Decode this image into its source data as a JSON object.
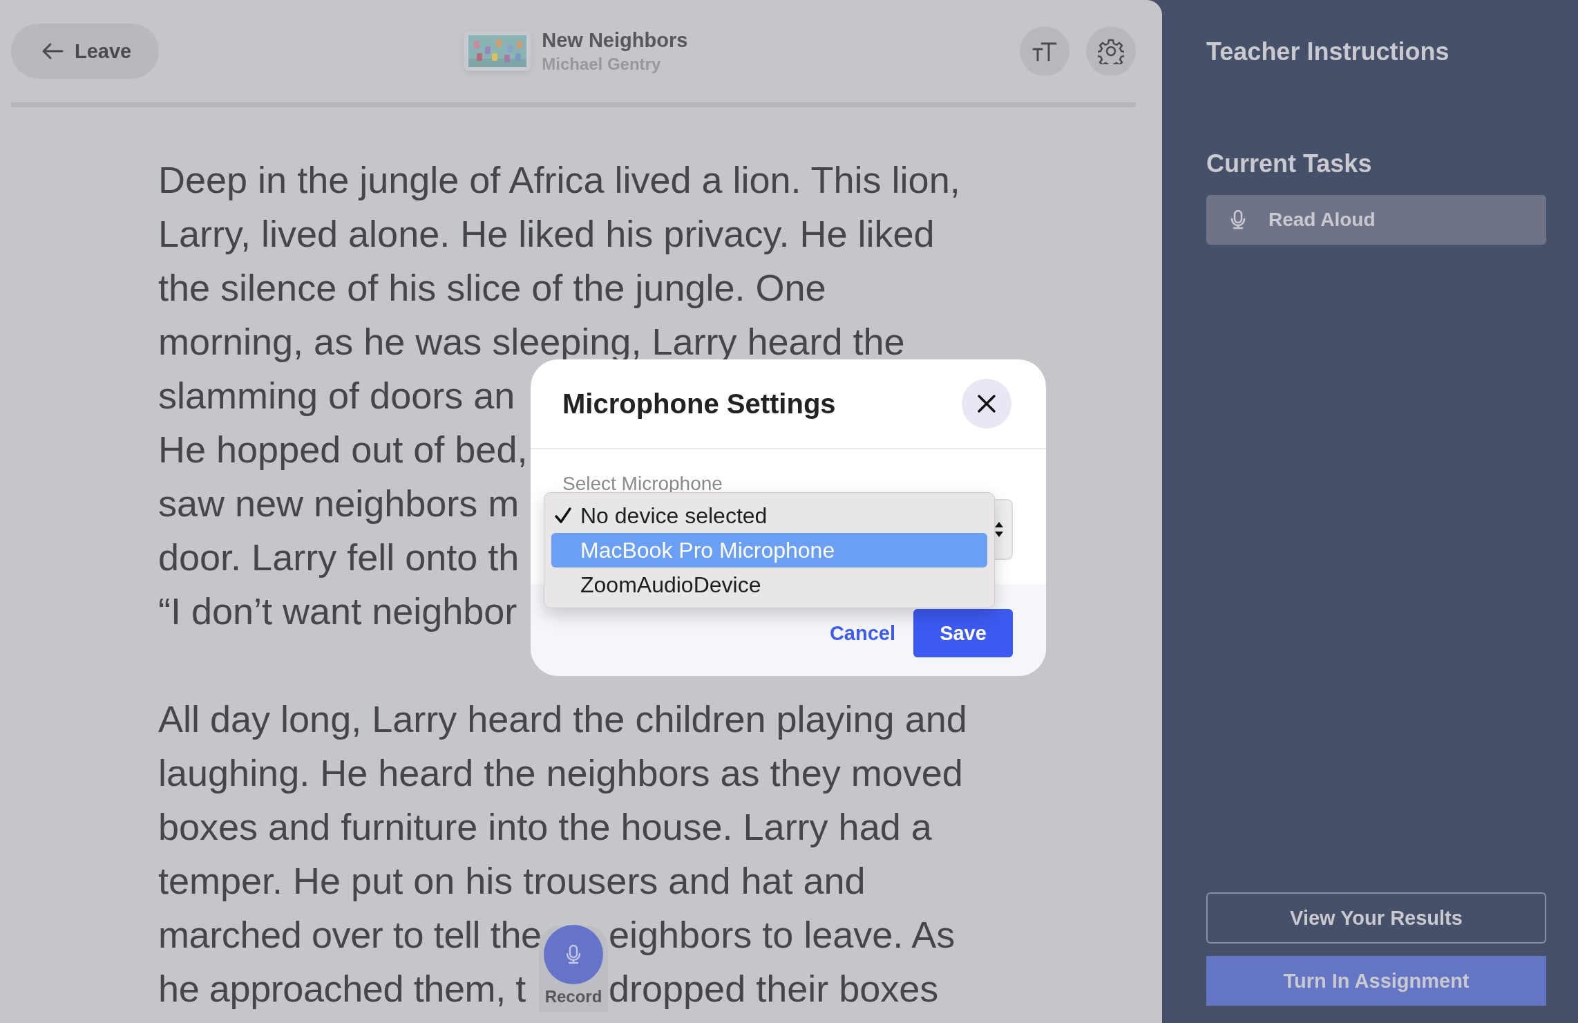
{
  "header": {
    "back_button": "Leave",
    "book": {
      "title": "New Neighbors",
      "author": "Michael Gentry"
    }
  },
  "story": {
    "paragraphs": [
      {
        "lines": [
          {
            "kind": "full",
            "text": "Deep in the jungle of Africa lived a lion. This lion,"
          },
          {
            "kind": "full",
            "text": "Larry, lived alone. He liked his privacy.  He liked"
          },
          {
            "kind": "full",
            "text": "the silence of his slice of the jungle. One"
          },
          {
            "kind": "full",
            "text": "morning, as he was sleeping, Larry heard the"
          },
          {
            "kind": "full",
            "text": "slamming of doors an"
          },
          {
            "kind": "full",
            "text": "He hopped out of bed,"
          },
          {
            "kind": "full",
            "text": "saw new neighbors m"
          },
          {
            "kind": "full",
            "text": "door. Larry fell onto th"
          },
          {
            "kind": "full",
            "text": "“I don’t want neighbor"
          }
        ]
      },
      {
        "lines": [
          {
            "kind": "full",
            "text": "All day long, Larry heard the children playing and"
          },
          {
            "kind": "full",
            "text": "laughing. He heard the neighbors as they moved"
          },
          {
            "kind": "full",
            "text": "boxes and furniture into the house. Larry had a"
          },
          {
            "kind": "full",
            "text": "temper. He put on his trousers and hat and"
          },
          {
            "kind": "split",
            "before": "marched over to tell the",
            "after": "eighbors to leave. As"
          },
          {
            "kind": "split",
            "before": "he approached them, t",
            "after": "dropped their boxes"
          }
        ]
      }
    ]
  },
  "record_button": {
    "label": "Record"
  },
  "modal": {
    "title": "Microphone Settings",
    "field_label": "Select Microphone",
    "options": [
      {
        "label": "No device selected",
        "selected": true,
        "highlighted": false
      },
      {
        "label": "MacBook Pro Microphone",
        "selected": false,
        "highlighted": true
      },
      {
        "label": "ZoomAudioDevice",
        "selected": false,
        "highlighted": false
      }
    ],
    "cancel": "Cancel",
    "save": "Save"
  },
  "sidebar": {
    "instructions_heading": "Teacher Instructions",
    "tasks_heading": "Current Tasks",
    "tasks": [
      {
        "label": "Read Aloud"
      }
    ],
    "buttons": [
      {
        "kind": "outline",
        "label": "View Your Results"
      },
      {
        "kind": "primary",
        "label": "Turn In Assignment"
      }
    ]
  }
}
